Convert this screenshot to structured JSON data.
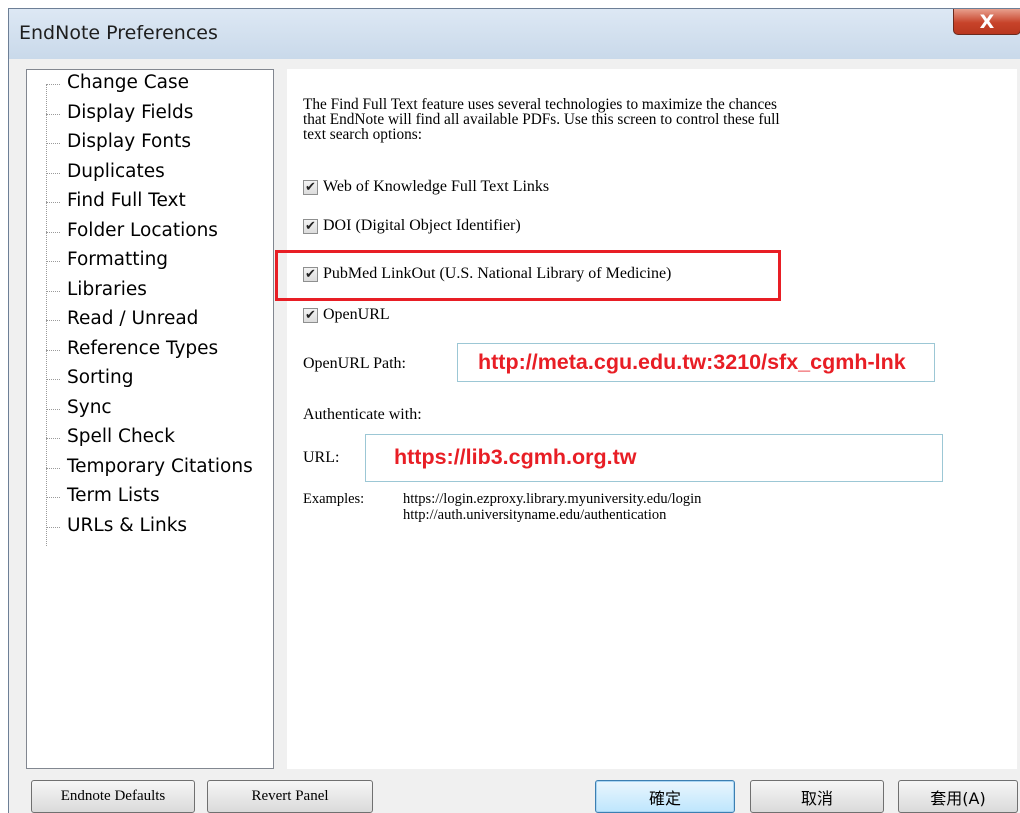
{
  "window": {
    "title": "EndNote Preferences",
    "close_label": "X"
  },
  "sidebar": {
    "items": [
      {
        "label": "Change Case"
      },
      {
        "label": "Display Fields"
      },
      {
        "label": "Display Fonts"
      },
      {
        "label": "Duplicates"
      },
      {
        "label": "Find Full Text"
      },
      {
        "label": "Folder Locations"
      },
      {
        "label": "Formatting"
      },
      {
        "label": "Libraries"
      },
      {
        "label": "Read / Unread"
      },
      {
        "label": "Reference Types"
      },
      {
        "label": "Sorting"
      },
      {
        "label": "Sync"
      },
      {
        "label": "Spell Check"
      },
      {
        "label": "Temporary Citations"
      },
      {
        "label": "Term Lists"
      },
      {
        "label": "URLs & Links"
      }
    ],
    "selected": "Find Full Text"
  },
  "panel": {
    "description_lines": [
      "The Find Full Text feature uses several technologies to maximize the chances",
      "that EndNote will find all available PDFs. Use this screen to control these full",
      "text search options:"
    ],
    "options": [
      {
        "label": "Web of Knowledge Full Text Links",
        "checked": true
      },
      {
        "label": "DOI (Digital Object Identifier)",
        "checked": true
      },
      {
        "label": "PubMed LinkOut (U.S. National Library of Medicine)",
        "checked": true
      },
      {
        "label": "OpenURL",
        "checked": true
      }
    ],
    "openurl_label": "OpenURL Path:",
    "openurl_value": "http://meta.cgu.edu.tw:3210/sfx_cgmh-lnk",
    "authenticate_label": "Authenticate with:",
    "url_label": "URL:",
    "url_value": "https://lib3.cgmh.org.tw",
    "examples_label": "Examples:",
    "examples": [
      "https://login.ezproxy.library.myuniversity.edu/login",
      "http://auth.universityname.edu/authentication"
    ],
    "highlight_color": "#e81e25"
  },
  "buttons": {
    "defaults": "Endnote Defaults",
    "revert": "Revert Panel",
    "ok": "確定",
    "cancel": "取消",
    "apply": "套用(A)"
  }
}
